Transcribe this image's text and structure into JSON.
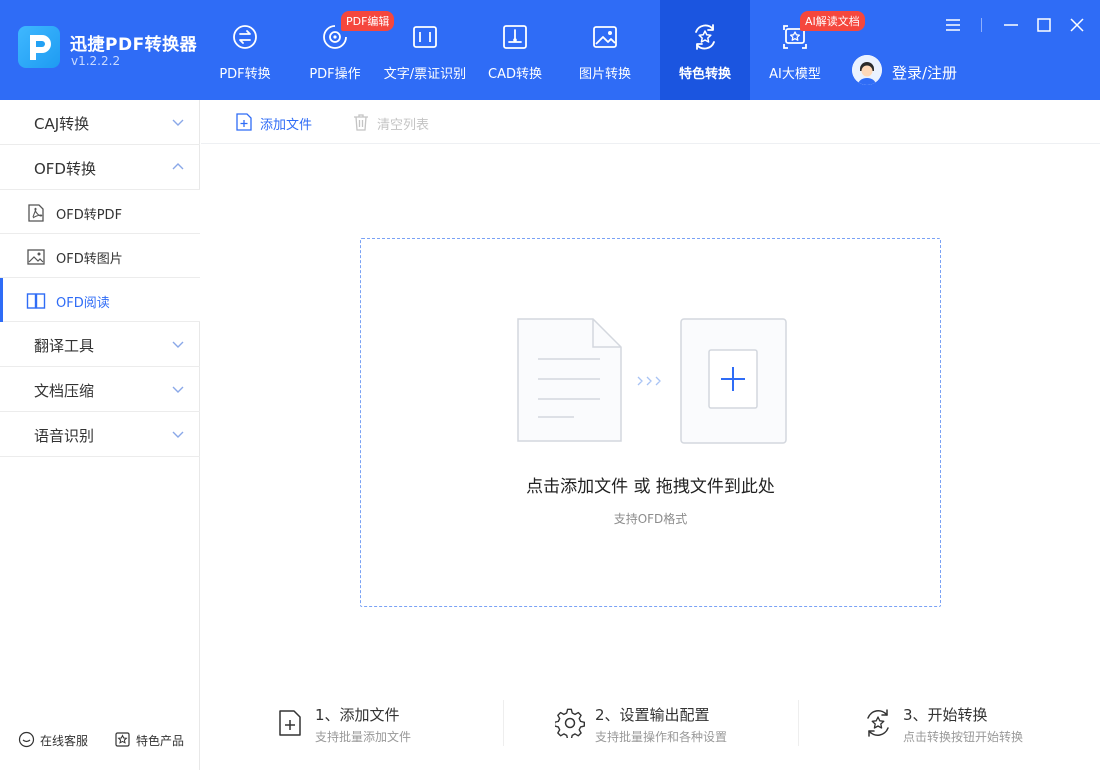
{
  "app": {
    "name": "迅捷PDF转换器",
    "version": "v1.2.2.2"
  },
  "nav": {
    "items": [
      {
        "label": "PDF转换",
        "icon": "swap-circle-icon"
      },
      {
        "label": "PDF操作",
        "icon": "gear-circle-icon",
        "badge": "PDF编辑"
      },
      {
        "label": "文字/票证识别",
        "icon": "scan-frame-icon"
      },
      {
        "label": "CAD转换",
        "icon": "cad-frame-icon"
      },
      {
        "label": "图片转换",
        "icon": "image-icon"
      },
      {
        "label": "特色转换",
        "icon": "star-swap-icon",
        "active": true
      },
      {
        "label": "AI大模型",
        "icon": "ai-star-icon",
        "badge": "AI解读文档"
      }
    ],
    "login_label": "登录/注册"
  },
  "sidebar": {
    "groups": [
      {
        "label": "CAJ转换",
        "expanded": false
      },
      {
        "label": "OFD转换",
        "expanded": true
      },
      {
        "label": "翻译工具",
        "expanded": false
      },
      {
        "label": "文档压缩",
        "expanded": false
      },
      {
        "label": "语音识别",
        "expanded": false
      }
    ],
    "ofd_items": [
      {
        "label": "OFD转PDF",
        "icon": "pdf-file-icon"
      },
      {
        "label": "OFD转图片",
        "icon": "image-file-icon"
      },
      {
        "label": "OFD阅读",
        "icon": "book-icon",
        "active": true
      }
    ],
    "footer": {
      "service": "在线客服",
      "products": "特色产品"
    }
  },
  "toolbar": {
    "add_file": "添加文件",
    "clear_list": "清空列表"
  },
  "dropzone": {
    "title": "点击添加文件 或 拖拽文件到此处",
    "subtitle": "支持OFD格式"
  },
  "steps": [
    {
      "title": "1、添加文件",
      "desc": "支持批量添加文件"
    },
    {
      "title": "2、设置输出配置",
      "desc": "支持批量操作和各种设置"
    },
    {
      "title": "3、开始转换",
      "desc": "点击转换按钮开始转换"
    }
  ],
  "colors": {
    "brand": "#2f6cf6",
    "brand_active": "#1b55e0",
    "badge": "#f5473d"
  }
}
